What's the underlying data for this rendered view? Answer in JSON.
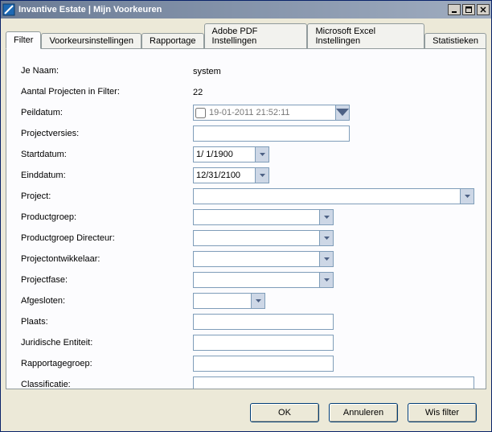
{
  "title": "Invantive Estate | Mijn Voorkeuren",
  "tabs": {
    "filter": "Filter",
    "voorkeurs": "Voorkeursinstellingen",
    "rapportage": "Rapportage",
    "pdf": "Adobe PDF Instellingen",
    "excel": "Microsoft Excel Instellingen",
    "stats": "Statistieken"
  },
  "labels": {
    "je_naam": "Je Naam:",
    "aantal": "Aantal Projecten in Filter:",
    "peildatum": "Peildatum:",
    "projectversies": "Projectversies:",
    "startdatum": "Startdatum:",
    "einddatum": "Einddatum:",
    "project": "Project:",
    "productgroep": "Productgroep:",
    "productgroep_dir": "Productgroep Directeur:",
    "projectontwikkelaar": "Projectontwikkelaar:",
    "projectfase": "Projectfase:",
    "afgesloten": "Afgesloten:",
    "plaats": "Plaats:",
    "juridische": "Juridische Entiteit:",
    "rapportagegroep": "Rapportagegroep:",
    "classificatie": "Classificatie:"
  },
  "values": {
    "je_naam": "system",
    "aantal": "22",
    "peildatum": "19-01-2011 21:52:11",
    "projectversies": "",
    "startdatum": "1/  1/1900",
    "einddatum": "12/31/2100",
    "project": "",
    "productgroep": "",
    "productgroep_dir": "",
    "projectontwikkelaar": "",
    "projectfase": "",
    "afgesloten": "",
    "plaats": "",
    "juridische": "",
    "rapportagegroep": "",
    "classificatie": ""
  },
  "buttons": {
    "ok": "OK",
    "annuleren": "Annuleren",
    "wis_filter": "Wis filter"
  }
}
